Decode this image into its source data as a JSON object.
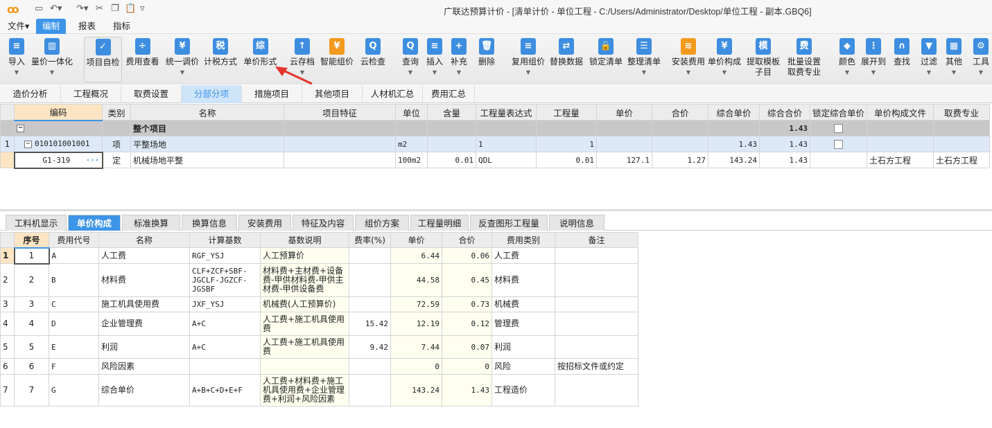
{
  "window": {
    "title": "广联达预算计价 - [清单计价 - 单位工程 - C:/Users/Administrator/Desktop/单位工程 - 副本.GBQ6]",
    "accent": "#3d95e8"
  },
  "quick_access": [
    {
      "icon": "save-icon",
      "glyph": "▭"
    },
    {
      "icon": "undo-icon",
      "glyph": "↶▾"
    },
    {
      "icon": "redo-icon",
      "glyph": "↷▾"
    },
    {
      "icon": "cut-icon",
      "glyph": "✂"
    },
    {
      "icon": "copy-icon",
      "glyph": "❐"
    },
    {
      "icon": "paste-icon",
      "glyph": "📋"
    },
    {
      "icon": "customize-icon",
      "glyph": "▿"
    }
  ],
  "menu": [
    {
      "label": "文件▾"
    },
    {
      "label": "编制",
      "active": true
    },
    {
      "label": "报表"
    },
    {
      "label": "指标"
    }
  ],
  "toolbar": [
    {
      "label": "导入",
      "icon": "import-icon",
      "glyph": "≡",
      "color": "#3d8ee0",
      "dd": true
    },
    {
      "label": "量价一体化",
      "icon": "integration-icon",
      "glyph": "▥",
      "color": "#3d8ee0",
      "dd": true
    },
    {
      "label": "项目自检",
      "icon": "self-check-icon",
      "glyph": "✓",
      "color": "#3d8ee0",
      "sel": true
    },
    {
      "label": "费用查看",
      "icon": "cost-view-icon",
      "glyph": "÷",
      "color": "#3d8ee0"
    },
    {
      "label": "统一调价",
      "icon": "adjust-price-icon",
      "glyph": "¥",
      "color": "#3d8ee0",
      "dd": true
    },
    {
      "label": "计税方式",
      "icon": "tax-method-icon",
      "glyph": "税",
      "color": "#3d8ee0"
    },
    {
      "label": "单价形式",
      "icon": "unit-price-form-icon",
      "glyph": "综",
      "color": "#3d8ee0"
    },
    {
      "label": "云存档",
      "icon": "cloud-save-icon",
      "glyph": "↑",
      "color": "#3d8ee0",
      "dd": true
    },
    {
      "label": "智能组价",
      "icon": "smart-price-icon",
      "glyph": "¥",
      "color": "#f39a1e"
    },
    {
      "label": "云检查",
      "icon": "cloud-check-icon",
      "glyph": "Q",
      "color": "#3d8ee0"
    },
    {
      "label": "查询",
      "icon": "query-icon",
      "glyph": "Q",
      "color": "#3d8ee0",
      "dd": true
    },
    {
      "label": "插入",
      "icon": "insert-icon",
      "glyph": "≡",
      "color": "#3d8ee0",
      "dd": true
    },
    {
      "label": "补充",
      "icon": "supplement-icon",
      "glyph": "+",
      "color": "#3d8ee0",
      "dd": true
    },
    {
      "label": "删除",
      "icon": "delete-icon",
      "glyph": "🗑",
      "color": "#3d8ee0"
    },
    {
      "label": "复用组价",
      "icon": "reuse-price-icon",
      "glyph": "≡",
      "color": "#3d8ee0",
      "dd": true
    },
    {
      "label": "替换数据",
      "icon": "replace-data-icon",
      "glyph": "⇄",
      "color": "#3d8ee0"
    },
    {
      "label": "锁定清单",
      "icon": "lock-icon",
      "glyph": "🔒",
      "color": "#3d8ee0"
    },
    {
      "label": "整理清单",
      "icon": "organize-list-icon",
      "glyph": "☰",
      "color": "#3d8ee0",
      "dd": true
    },
    {
      "label": "安装费用",
      "icon": "install-cost-icon",
      "glyph": "≋",
      "color": "#f39a1e",
      "dd": true
    },
    {
      "label": "单价构成",
      "icon": "price-composition-icon",
      "glyph": "¥",
      "color": "#3d8ee0",
      "dd": true
    },
    {
      "label": "提取模板\n子目",
      "icon": "template-icon",
      "glyph": "模",
      "color": "#3d8ee0"
    },
    {
      "label": "批量设置\n取费专业",
      "icon": "fee-icon",
      "glyph": "费",
      "color": "#3d8ee0"
    },
    {
      "label": "颜色",
      "icon": "color-icon",
      "glyph": "◆",
      "color": "#3d8ee0",
      "dd": true
    },
    {
      "label": "展开到",
      "icon": "expand-icon",
      "glyph": "⋮",
      "color": "#3d8ee0",
      "dd": true
    },
    {
      "label": "查找",
      "icon": "find-icon",
      "glyph": "∩",
      "color": "#3d8ee0"
    },
    {
      "label": "过滤",
      "icon": "filter-icon",
      "glyph": "▼",
      "color": "#3d8ee0",
      "dd": true
    },
    {
      "label": "其他",
      "icon": "other-icon",
      "glyph": "▦",
      "color": "#3d8ee0",
      "dd": true
    },
    {
      "label": "工具",
      "icon": "tools-icon",
      "glyph": "⚙",
      "color": "#3d8ee0",
      "dd": true
    }
  ],
  "nav_tabs": [
    {
      "label": "造价分析"
    },
    {
      "label": "工程概况"
    },
    {
      "label": "取费设置"
    },
    {
      "label": "分部分项",
      "active": true
    },
    {
      "label": "措施项目"
    },
    {
      "label": "其他项目"
    },
    {
      "label": "人材机汇总"
    },
    {
      "label": "费用汇总"
    }
  ],
  "grid": {
    "columns": [
      "",
      "编码",
      "类别",
      "名称",
      "项目特征",
      "单位",
      "含量",
      "工程量表达式",
      "工程量",
      "单价",
      "合价",
      "综合单价",
      "综合合价",
      "锁定综合单价",
      "单价构成文件",
      "取费专业"
    ],
    "rows": [
      [
        "",
        "整个项目",
        "",
        "",
        "",
        "",
        "",
        "",
        "",
        "",
        "",
        "",
        "1.43",
        "☐",
        "",
        ""
      ],
      [
        "1",
        "010101001001",
        "项",
        "平整场地",
        "",
        "m2",
        "",
        "1",
        "1",
        "",
        "",
        "1.43",
        "1.43",
        "☐",
        "",
        ""
      ],
      [
        "",
        "G1-319",
        "定",
        "机械场地平整",
        "",
        "100m2",
        "0.01",
        "QDL",
        "0.01",
        "127.1",
        "1.27",
        "143.24",
        "1.43",
        "",
        "土石方工程",
        "土石方工程"
      ]
    ]
  },
  "sub_tabs": [
    {
      "label": "工料机显示"
    },
    {
      "label": "单价构成",
      "active": true
    },
    {
      "label": "标准换算"
    },
    {
      "label": "换算信息"
    },
    {
      "label": "安装费用"
    },
    {
      "label": "特征及内容"
    },
    {
      "label": "组价方案"
    },
    {
      "label": "工程量明细"
    },
    {
      "label": "反查图形工程量"
    },
    {
      "label": "说明信息"
    }
  ],
  "composition": {
    "columns": [
      "",
      "序号",
      "费用代号",
      "名称",
      "计算基数",
      "基数说明",
      "费率(%)",
      "单价",
      "合价",
      "费用类别",
      "备注"
    ],
    "rows": [
      [
        "1",
        "1",
        "A",
        "人工费",
        "RGF_YSJ",
        "人工预算价",
        "",
        "6.44",
        "0.06",
        "人工费",
        ""
      ],
      [
        "2",
        "2",
        "B",
        "材料费",
        "CLF+ZCF+SBF-JGCLF-JGZCF-JGSBF",
        "材料费+主材费+设备费-甲供材料费-甲供主材费-甲供设备费",
        "",
        "44.58",
        "0.45",
        "材料费",
        ""
      ],
      [
        "3",
        "3",
        "C",
        "施工机具使用费",
        "JXF_YSJ",
        "机械费(人工预算价)",
        "",
        "72.59",
        "0.73",
        "机械费",
        ""
      ],
      [
        "4",
        "4",
        "D",
        "企业管理费",
        "A+C",
        "人工费+施工机具使用费",
        "15.42",
        "12.19",
        "0.12",
        "管理费",
        ""
      ],
      [
        "5",
        "5",
        "E",
        "利润",
        "A+C",
        "人工费+施工机具使用费",
        "9.42",
        "7.44",
        "0.07",
        "利润",
        ""
      ],
      [
        "6",
        "6",
        "F",
        "风险因素",
        "",
        "",
        "",
        "0",
        "0",
        "风险",
        "按招标文件或约定"
      ],
      [
        "7",
        "7",
        "G",
        "综合单价",
        "A+B+C+D+E+F",
        "人工费+材料费+施工机具使用费+企业管理费+利润+风险因素",
        "",
        "143.24",
        "1.43",
        "工程造价",
        ""
      ]
    ]
  }
}
